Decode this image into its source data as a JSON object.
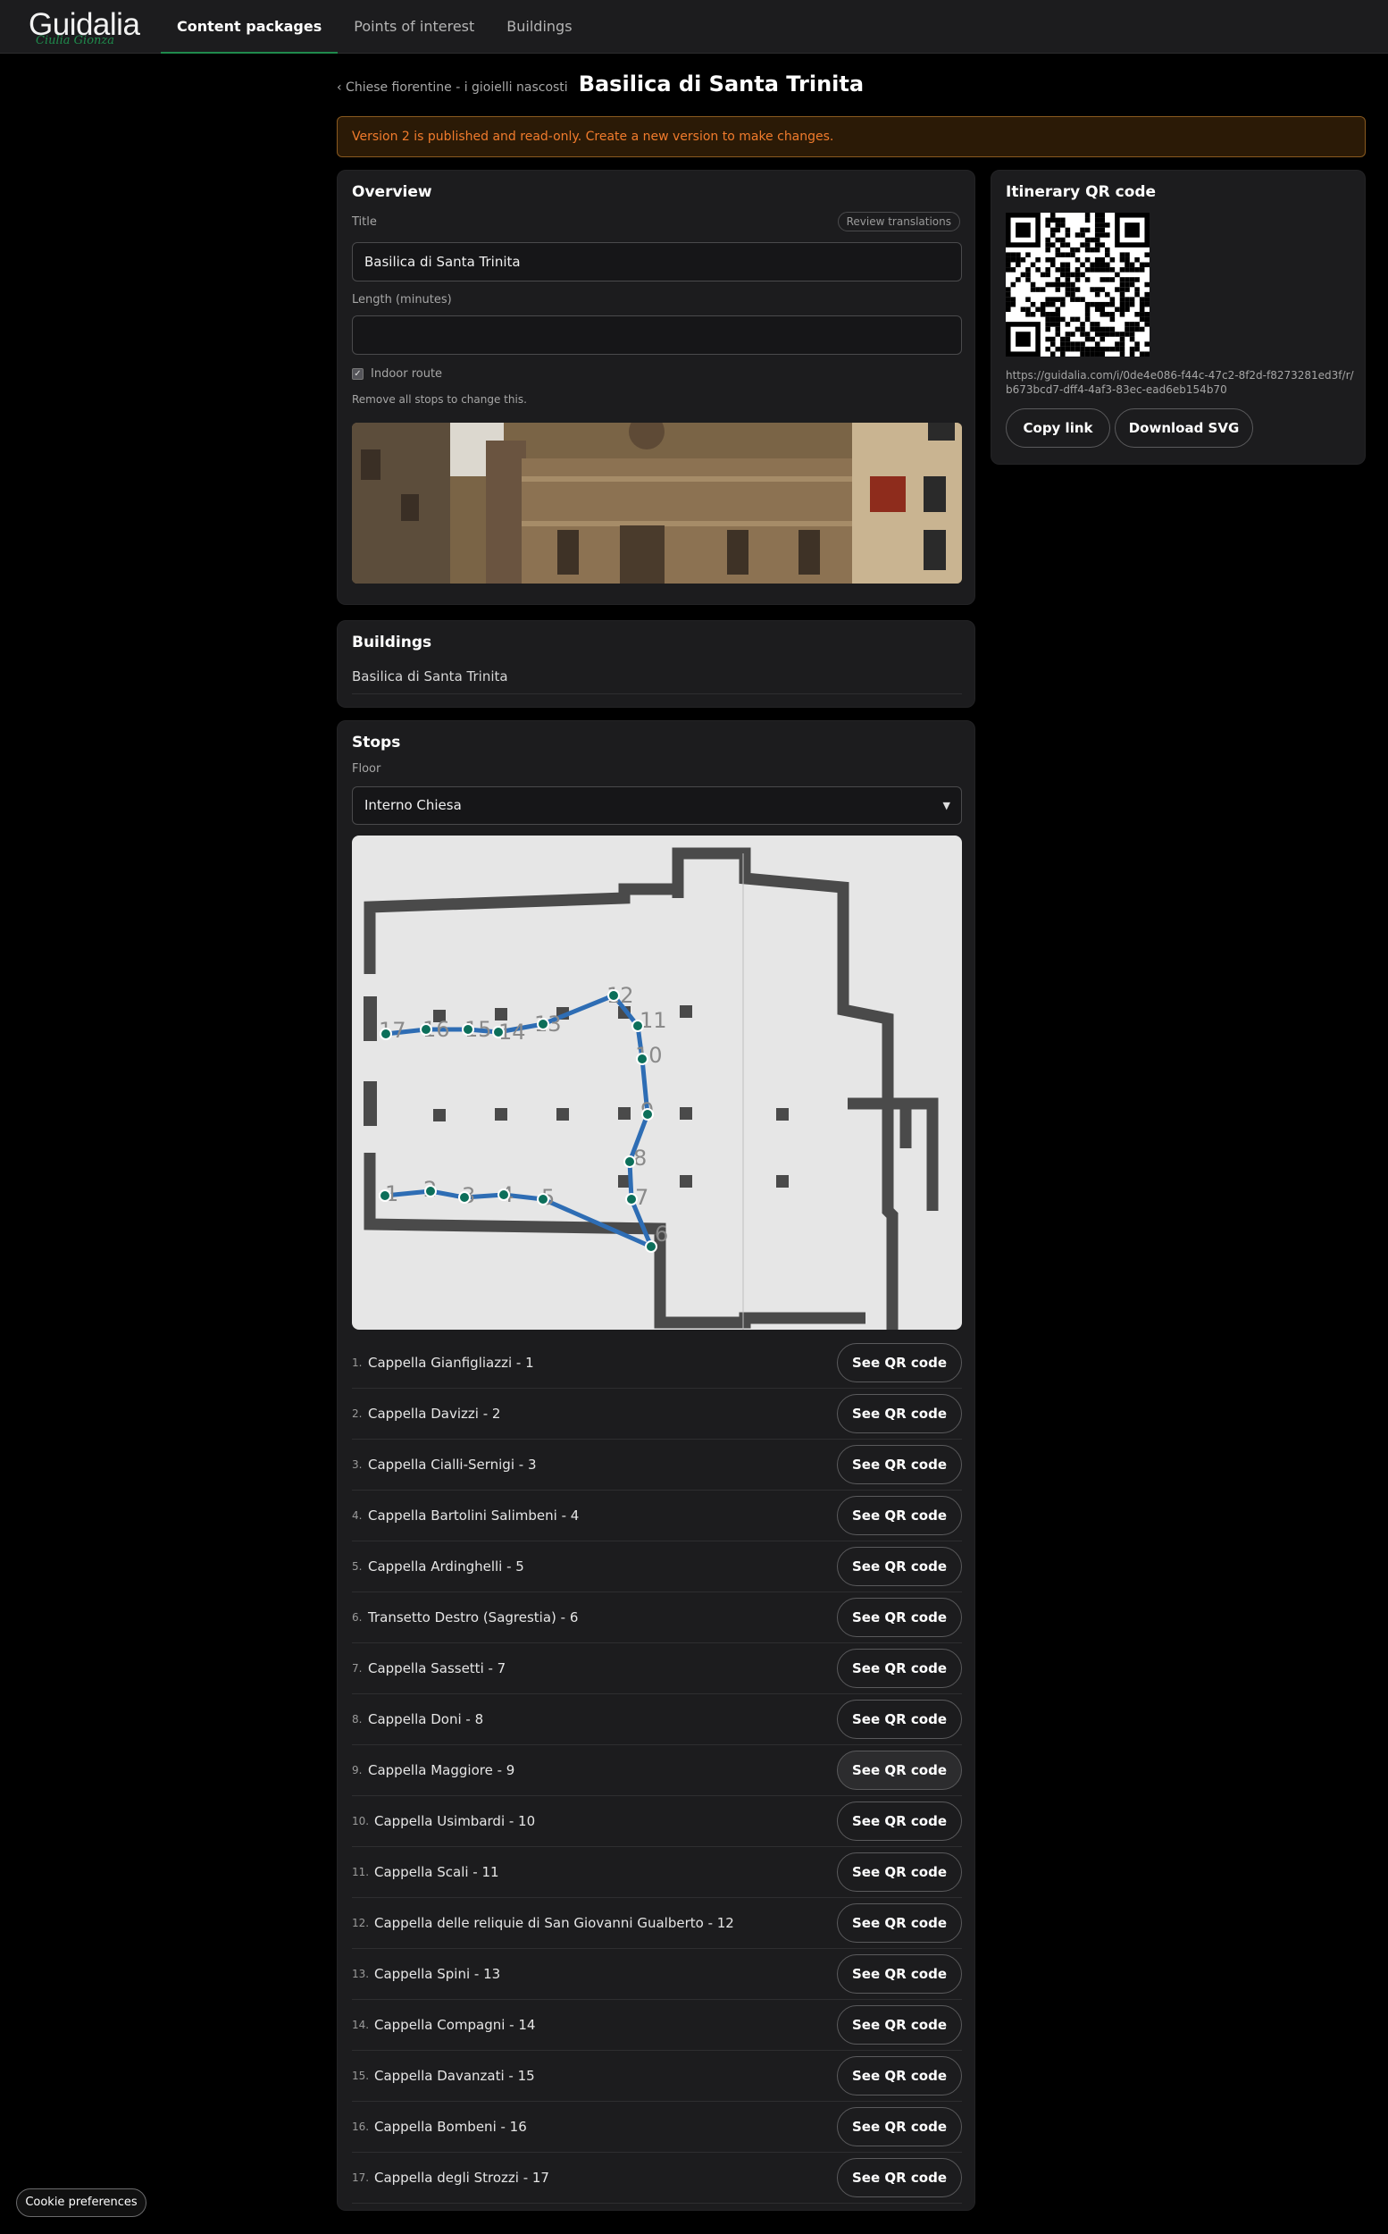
{
  "app": {
    "logo_text": "Guidalia",
    "logo_tagline": "Ciulia Gionza",
    "nav": [
      {
        "label": "Content packages",
        "active": true
      },
      {
        "label": "Points of interest",
        "active": false
      },
      {
        "label": "Buildings",
        "active": false
      }
    ]
  },
  "breadcrumb": {
    "back_label": "‹ Chiese fiorentine - i gioielli nascosti",
    "title": "Basilica di Santa Trinita"
  },
  "alert": {
    "text": "Version 2 is published and read-only. Create a new version to make changes.",
    "color": "#f07b2c"
  },
  "overview": {
    "heading": "Overview",
    "title_label": "Title",
    "review_label": "Review translations",
    "title_value": "Basilica di Santa Trinita",
    "length_label": "Length (minutes)",
    "length_value": "",
    "indoor_label": "Indoor route",
    "indoor_checked": true,
    "indoor_hint": "Remove all stops to change this."
  },
  "qr": {
    "heading": "Itinerary QR code",
    "url": "https://guidalia.com/i/0de4e086-f44c-47c2-8f2d-f8273281ed3f/r/b673bcd7-dff4-4af3-83ec-ead6eb154b70",
    "copy_label": "Copy link",
    "download_label": "Download SVG"
  },
  "buildings": {
    "heading": "Buildings",
    "items": [
      "Basilica di Santa Trinita"
    ]
  },
  "stops": {
    "heading": "Stops",
    "floor_label": "Floor",
    "floor_value": "Interno Chiesa",
    "button_label": "See QR code",
    "route_color": "#2e6db4",
    "marker_color": "#0c6f5a",
    "items": [
      {
        "num": "1.",
        "name": "Cappella Gianfigliazzi - 1",
        "map_label": "1"
      },
      {
        "num": "2.",
        "name": "Cappella Davizzi - 2",
        "map_label": "2"
      },
      {
        "num": "3.",
        "name": "Cappella Cialli-Sernigi - 3",
        "map_label": "3"
      },
      {
        "num": "4.",
        "name": "Cappella Bartolini Salimbeni - 4",
        "map_label": "4"
      },
      {
        "num": "5.",
        "name": "Cappella Ardinghelli - 5",
        "map_label": "5"
      },
      {
        "num": "6.",
        "name": "Transetto Destro (Sagrestia) - 6",
        "map_label": "6"
      },
      {
        "num": "7.",
        "name": "Cappella Sassetti - 7",
        "map_label": "7"
      },
      {
        "num": "8.",
        "name": "Cappella Doni - 8",
        "map_label": "8"
      },
      {
        "num": "9.",
        "name": "Cappella Maggiore - 9",
        "map_label": "9"
      },
      {
        "num": "10.",
        "name": "Cappella Usimbardi - 10",
        "map_label": "10"
      },
      {
        "num": "11.",
        "name": "Cappella Scali - 11",
        "map_label": "11"
      },
      {
        "num": "12.",
        "name": "Cappella delle reliquie di San Giovanni Gualberto - 12",
        "map_label": "12"
      },
      {
        "num": "13.",
        "name": "Cappella Spini - 13",
        "map_label": "13"
      },
      {
        "num": "14.",
        "name": "Cappella Compagni - 14",
        "map_label": "14"
      },
      {
        "num": "15.",
        "name": "Cappella Davanzati - 15",
        "map_label": "15"
      },
      {
        "num": "16.",
        "name": "Cappella Bombeni - 16",
        "map_label": "16"
      },
      {
        "num": "17.",
        "name": "Cappella degli Strozzi - 17",
        "map_label": "17"
      }
    ]
  },
  "cookie_label": "Cookie preferences"
}
